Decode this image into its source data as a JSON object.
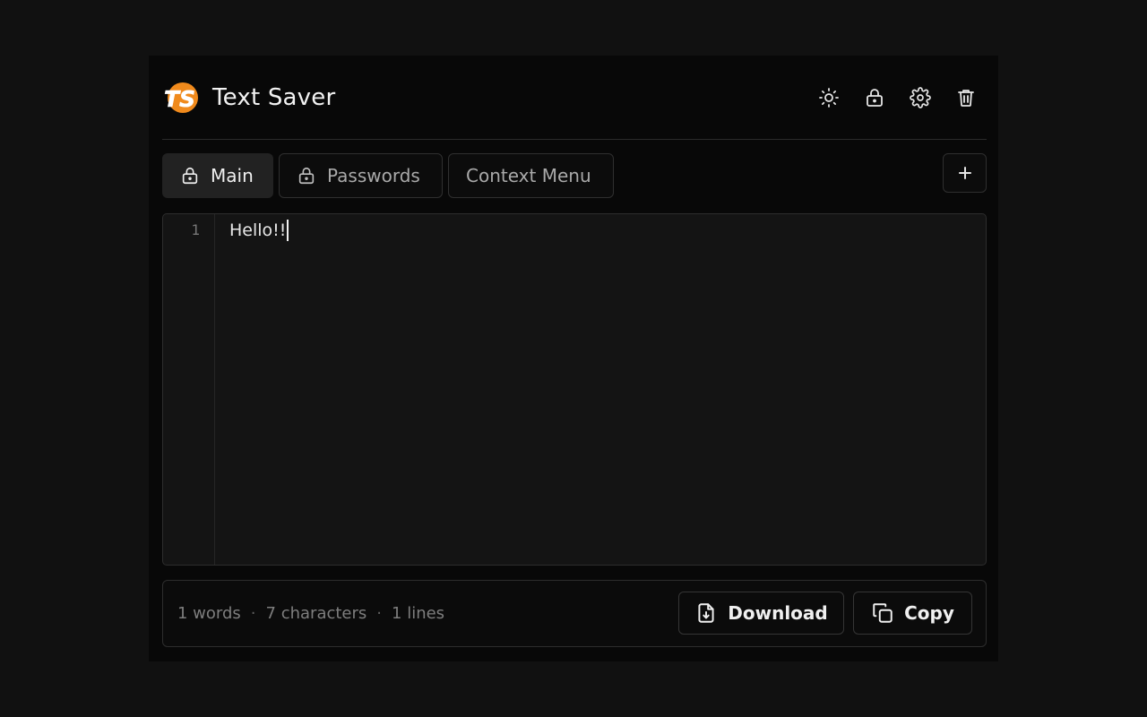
{
  "app": {
    "title": "Text Saver",
    "logo_text": "TS",
    "accent": "#f08a1c"
  },
  "header": {
    "actions": [
      {
        "icon": "sun-icon",
        "label": "theme"
      },
      {
        "icon": "lock-icon",
        "label": "lock"
      },
      {
        "icon": "gear-icon",
        "label": "settings"
      },
      {
        "icon": "trash-icon",
        "label": "delete"
      }
    ]
  },
  "tabs": [
    {
      "label": "Main",
      "locked": true,
      "active": true
    },
    {
      "label": "Passwords",
      "locked": true,
      "active": false
    },
    {
      "label": "Context Menu",
      "locked": false,
      "active": false
    }
  ],
  "add_tab_label": "+",
  "editor": {
    "line_numbers": [
      "1"
    ],
    "content": "Hello!!"
  },
  "footer": {
    "words": "1 words",
    "characters": "7 characters",
    "lines": "1 lines",
    "separator": "·",
    "download_label": "Download",
    "copy_label": "Copy"
  }
}
